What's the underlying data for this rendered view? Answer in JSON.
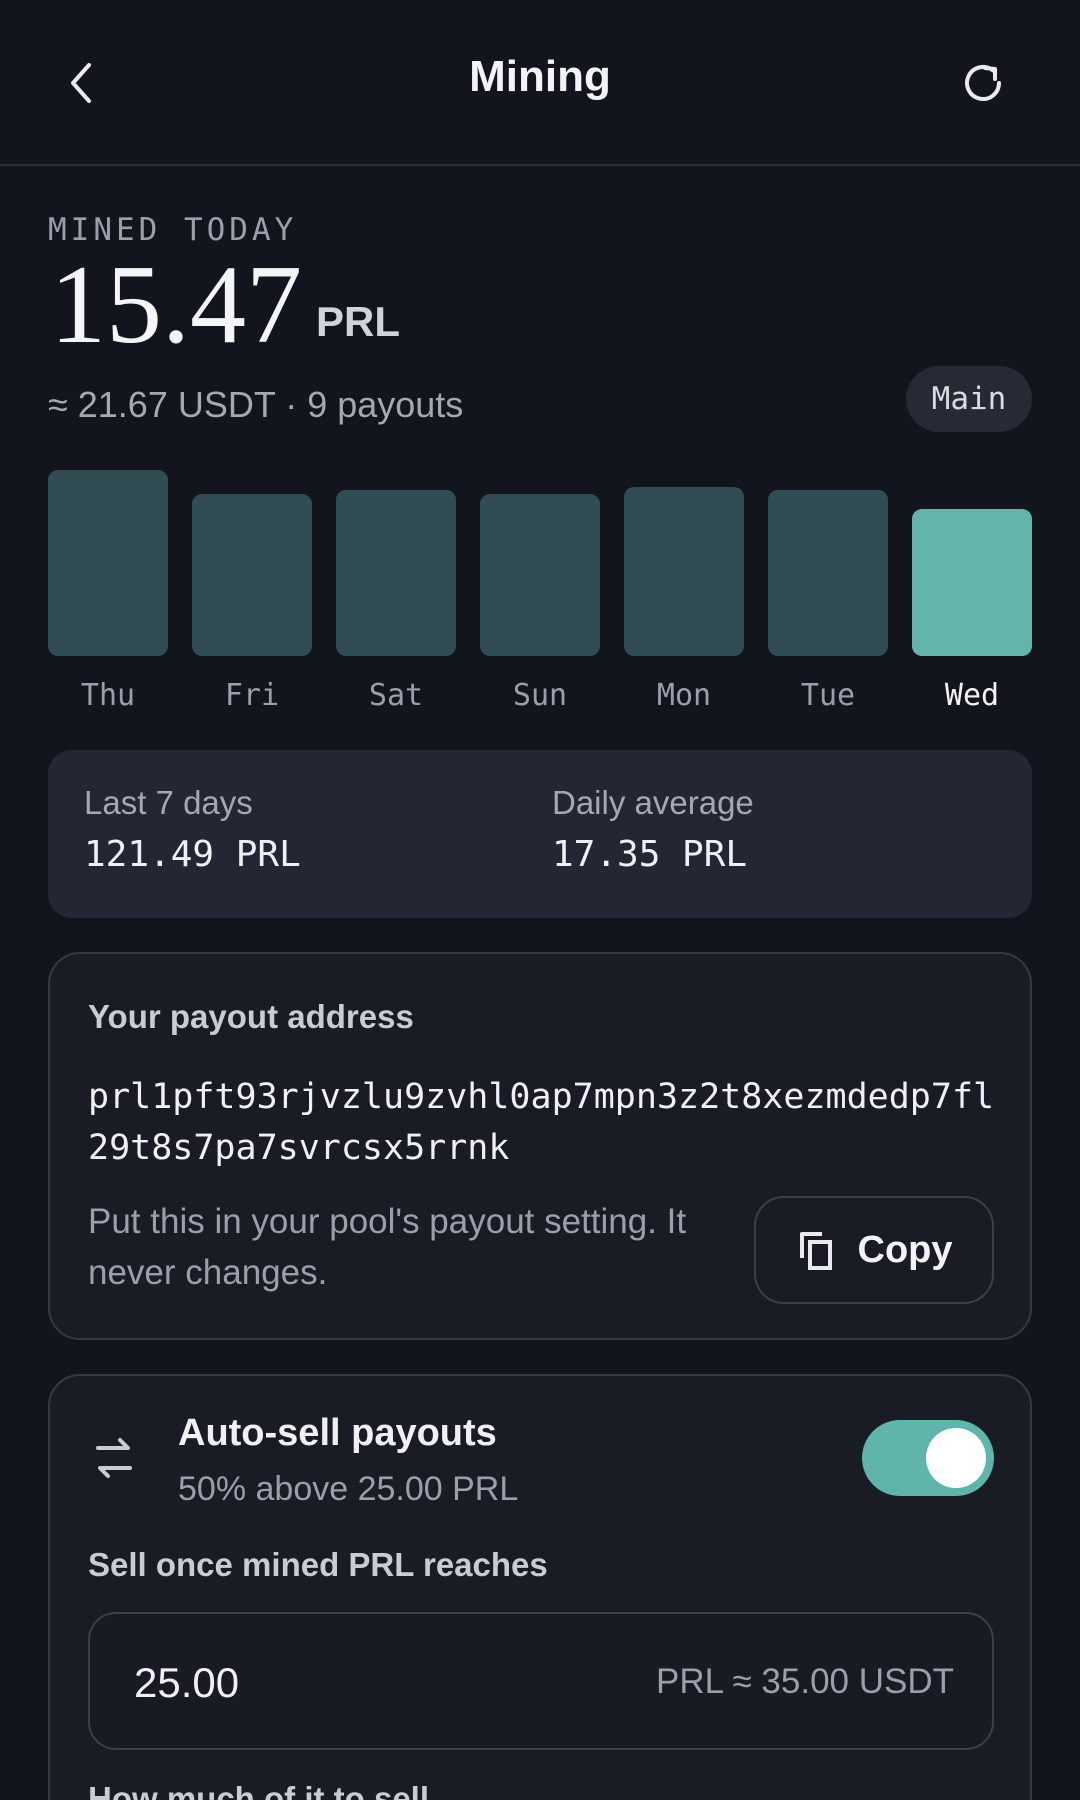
{
  "header": {
    "title": "Mining",
    "back_icon": "chevron-left-icon",
    "refresh_icon": "refresh-icon"
  },
  "summary": {
    "label": "MINED TODAY",
    "amount": "15.47",
    "unit": "PRL",
    "sub": "≈ 21.67 USDT · 9 payouts",
    "wallet_pill": "Main"
  },
  "chart_data": {
    "type": "bar",
    "categories": [
      "Thu",
      "Fri",
      "Sat",
      "Sun",
      "Mon",
      "Tue",
      "Wed"
    ],
    "values": [
      18.6,
      16.2,
      16.6,
      16.2,
      16.9,
      16.6,
      14.7
    ],
    "highlight_index": 6,
    "colors": {
      "bar": "#2f4d52",
      "active": "#63b5ab"
    }
  },
  "stats": {
    "last7_label": "Last 7 days",
    "last7_value": "121.49 PRL",
    "avg_label": "Daily average",
    "avg_value": "17.35 PRL"
  },
  "address_card": {
    "title": "Your payout address",
    "address": "prl1pft93rjvzlu9zvhl0ap7mpn3z2t8xezmdedp7fl29t8s7pa7svrcsx5rrnk",
    "hint": "Put this in your pool's payout setting. It never changes.",
    "copy_label": "Copy"
  },
  "auto_sell": {
    "title": "Auto-sell payouts",
    "subtitle": "50% above 25.00 PRL",
    "enabled": true,
    "threshold_label": "Sell once mined PRL reaches",
    "threshold_value": "25.00",
    "threshold_suffix": "PRL ≈ 35.00 USDT",
    "next_label": "How much of it to sell"
  },
  "colors": {
    "accent": "#5fb5aa",
    "background": "#12151d",
    "card": "#232733"
  }
}
